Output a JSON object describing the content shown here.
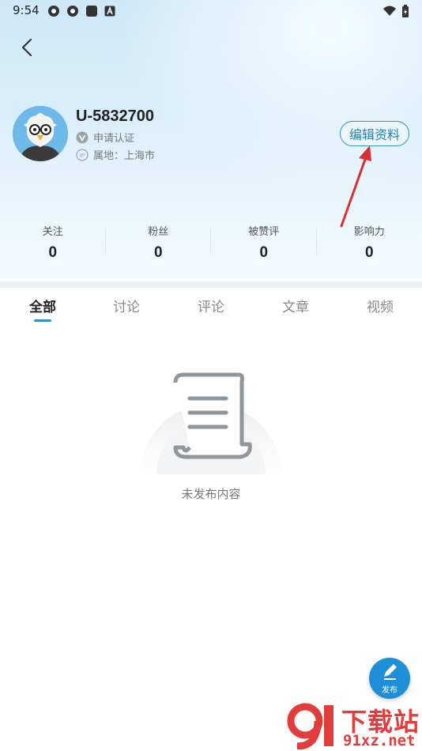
{
  "status_bar": {
    "time": "9:54"
  },
  "profile": {
    "username": "U-5832700",
    "verify_label": "申请认证",
    "location_label": "属地：上海市",
    "edit_button_label": "编辑资料"
  },
  "stats": [
    {
      "label": "关注",
      "value": "0"
    },
    {
      "label": "粉丝",
      "value": "0"
    },
    {
      "label": "被赞评",
      "value": "0"
    },
    {
      "label": "影响力",
      "value": "0"
    }
  ],
  "tabs": [
    {
      "label": "全部",
      "active": true
    },
    {
      "label": "讨论",
      "active": false
    },
    {
      "label": "评论",
      "active": false
    },
    {
      "label": "文章",
      "active": false
    },
    {
      "label": "视频",
      "active": false
    }
  ],
  "empty_state": {
    "text": "未发布内容"
  },
  "fab": {
    "label": "发布"
  },
  "watermark": {
    "big": "下载站",
    "small": "91xz.net",
    "logo": "9"
  },
  "colors": {
    "accent": "#2a8fd0",
    "edit_border": "#3a8fbf",
    "annotation_arrow": "#d83030",
    "watermark": "#e23d3d"
  }
}
